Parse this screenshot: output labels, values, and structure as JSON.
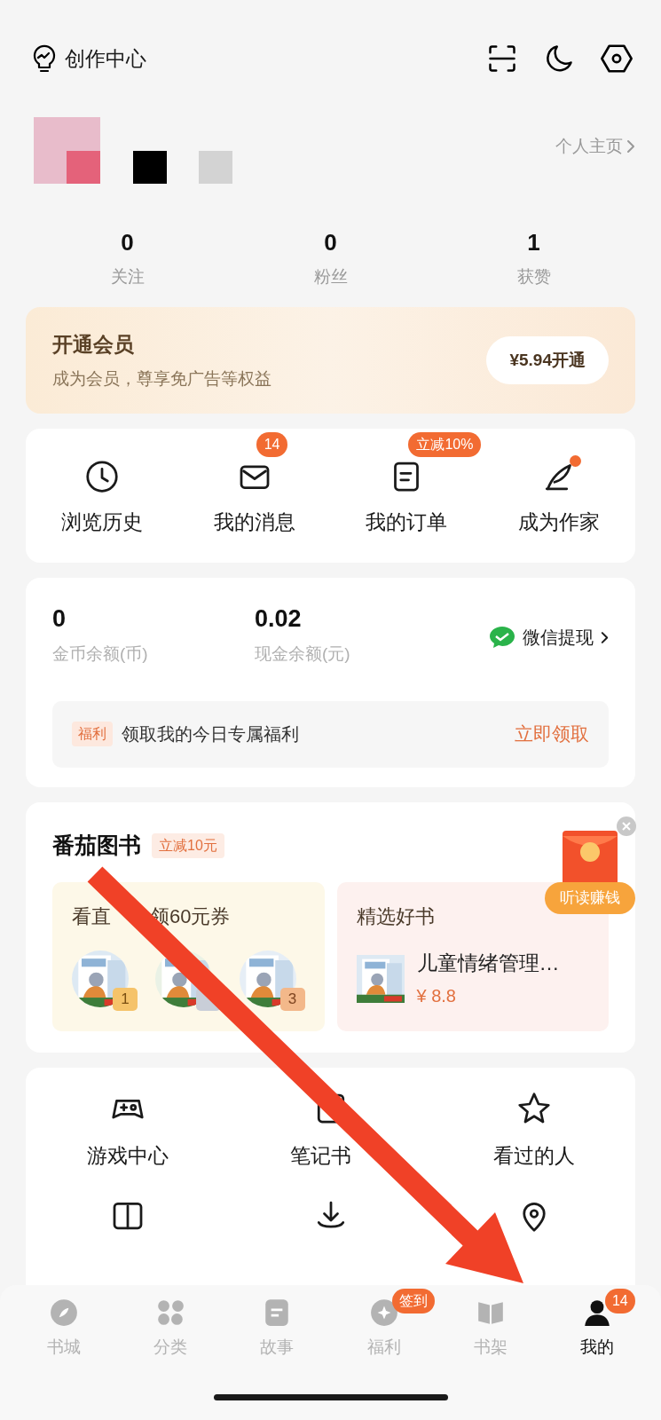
{
  "header": {
    "title": "创作中心"
  },
  "profile": {
    "homepage_link": "个人主页"
  },
  "stats": [
    {
      "value": "0",
      "label": "关注"
    },
    {
      "value": "0",
      "label": "粉丝"
    },
    {
      "value": "1",
      "label": "获赞"
    }
  ],
  "vip": {
    "title": "开通会员",
    "subtitle": "成为会员，尊享免广告等权益",
    "button": "¥5.94开通"
  },
  "shortcuts": [
    {
      "kind": "clock",
      "label": "浏览历史"
    },
    {
      "kind": "mail",
      "label": "我的消息",
      "badge": "14"
    },
    {
      "kind": "order",
      "label": "我的订单",
      "badge": "立减10%"
    },
    {
      "kind": "quill",
      "label": "成为作家",
      "dot": true
    }
  ],
  "wallet": {
    "balances": [
      {
        "value": "0",
        "label": "金币余额(币)"
      },
      {
        "value": "0.02",
        "label": "现金余额(元)"
      }
    ],
    "withdraw": "微信提现",
    "benefit_tag": "福利",
    "benefit_text": "领取我的今日专属福利",
    "benefit_action": "立即领取"
  },
  "books": {
    "title": "番茄图书",
    "tag": "立减10元",
    "live": {
      "title_parts": [
        "看直",
        "领60元券"
      ],
      "covers": [
        {
          "kind": "ranked",
          "rank": "1"
        },
        {
          "kind": "hidden_rank"
        },
        {
          "kind": "ranked",
          "rank": "3"
        }
      ]
    },
    "picked": {
      "title": "精选好书",
      "book_title": "儿童情绪管理…",
      "price": "¥ 8.8"
    }
  },
  "floating": {
    "button": "听读赚钱"
  },
  "grid": [
    {
      "kind": "gamepad",
      "label": "游戏中心"
    },
    {
      "kind": "note",
      "label": "笔记书"
    },
    {
      "kind": "star",
      "label": "看过的人"
    },
    {
      "kind": "book"
    },
    {
      "kind": "download"
    },
    {
      "kind": "pin"
    }
  ],
  "tabbar": [
    {
      "kind": "compass",
      "label": "书城",
      "selected": false
    },
    {
      "kind": "category",
      "label": "分类",
      "selected": false
    },
    {
      "kind": "story",
      "label": "故事",
      "selected": false
    },
    {
      "kind": "gift",
      "label": "福利",
      "selected": false,
      "badge": "签到"
    },
    {
      "kind": "shelf",
      "label": "书架",
      "selected": false
    },
    {
      "kind": "person",
      "label": "我的",
      "selected": true,
      "badge": "14"
    }
  ]
}
